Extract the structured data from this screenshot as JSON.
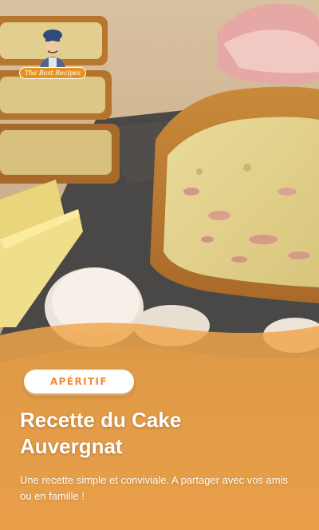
{
  "brand": {
    "logo_text": "The Best Recipes"
  },
  "story": {
    "category": "APÉRITIF",
    "title_line1": "Recette du Cake",
    "title_line2": "Auvergnat",
    "description": "Une recette simple et conviviale. A partager avec vos amis ou en famille !"
  },
  "colors": {
    "overlay": "#f0a446",
    "accent": "#ee8a3c",
    "text": "#ffffff"
  },
  "icons": {
    "logo": "chef-icon"
  }
}
